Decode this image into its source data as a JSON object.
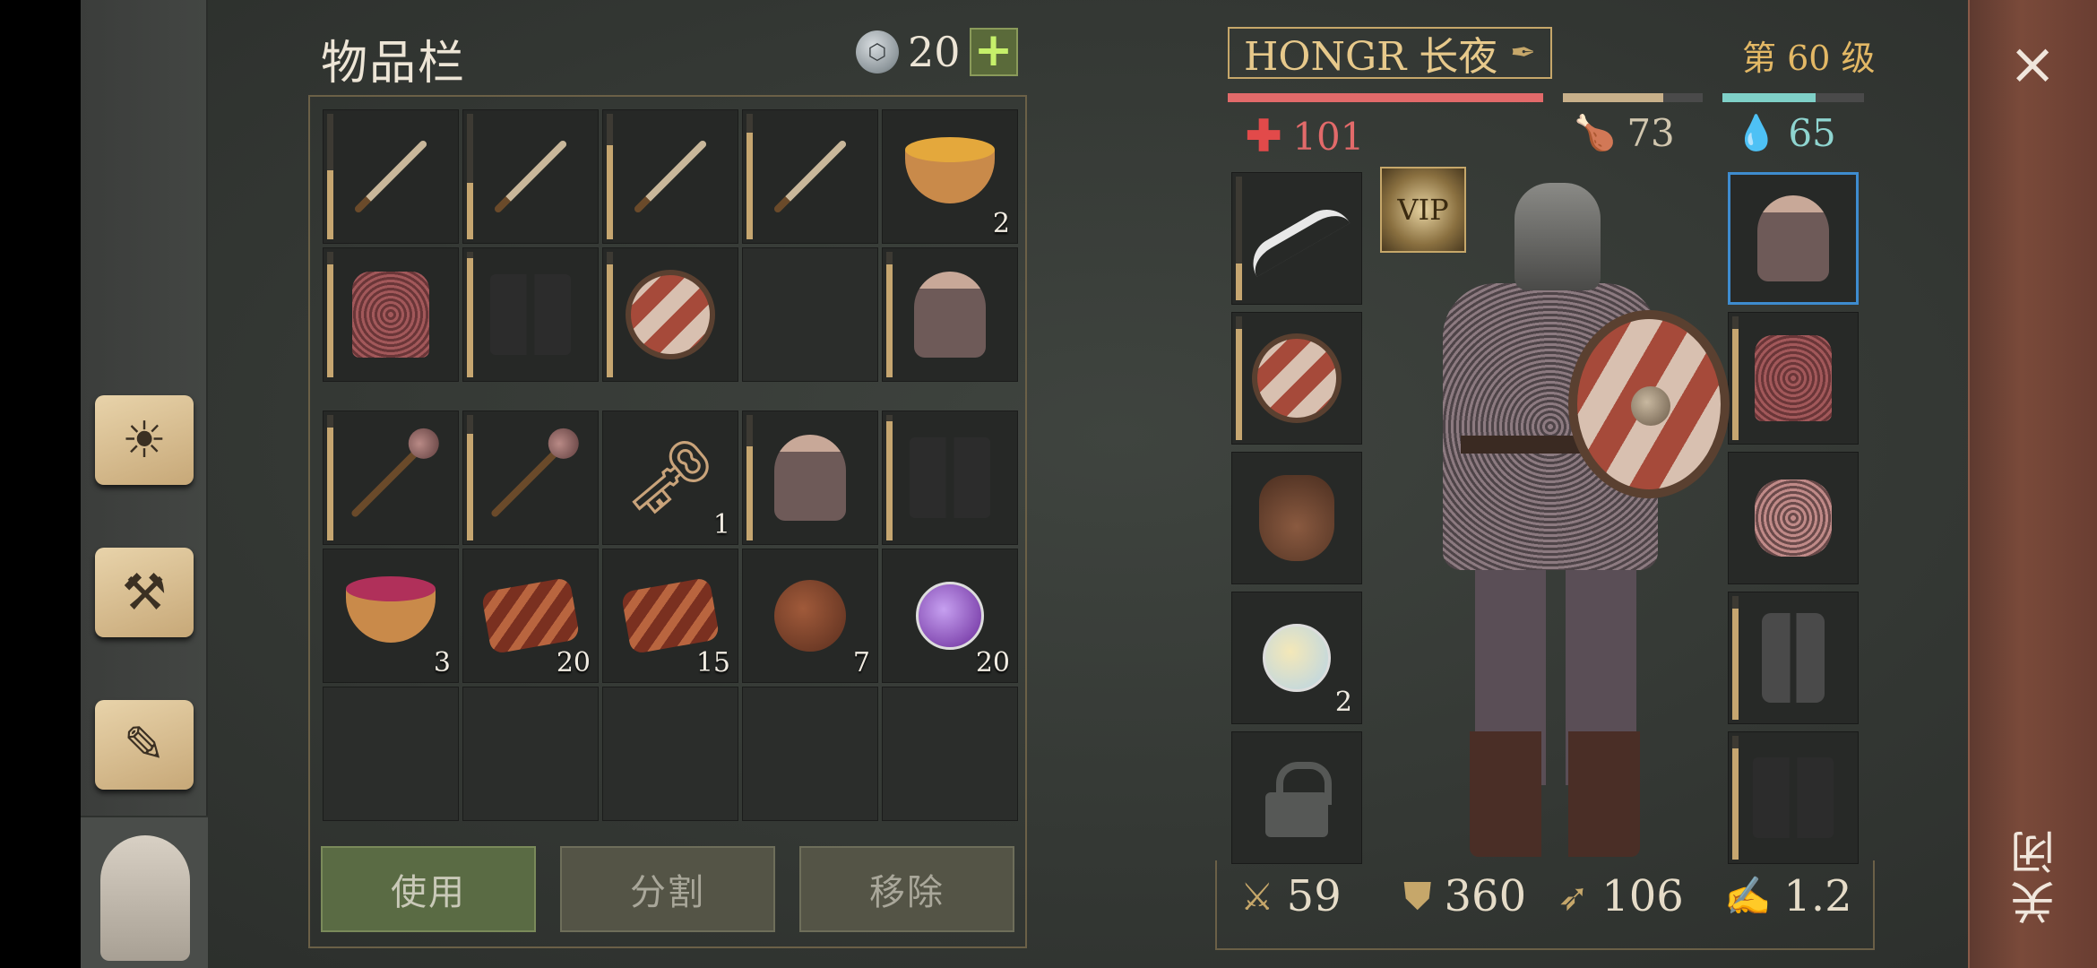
{
  "inventory": {
    "title": "物品栏",
    "currency_value": "20",
    "add_label": "+",
    "items_top": [
      {
        "name": "sword",
        "durability": 0.55,
        "count": ""
      },
      {
        "name": "sword",
        "durability": 0.45,
        "count": ""
      },
      {
        "name": "sword",
        "durability": 0.75,
        "count": ""
      },
      {
        "name": "sword",
        "durability": 0.85,
        "count": ""
      },
      {
        "name": "soup-bowl",
        "durability": null,
        "count": "2"
      },
      {
        "name": "chainmail",
        "durability": 0.9,
        "count": ""
      },
      {
        "name": "boots",
        "durability": 0.95,
        "count": ""
      },
      {
        "name": "round-shield",
        "durability": 0.9,
        "count": ""
      },
      {
        "name": "empty",
        "durability": null,
        "count": ""
      },
      {
        "name": "great-helm",
        "durability": 0.9,
        "count": ""
      }
    ],
    "items_bottom": [
      {
        "name": "mace",
        "durability": 0.9,
        "count": ""
      },
      {
        "name": "mace",
        "durability": 0.85,
        "count": ""
      },
      {
        "name": "key",
        "durability": null,
        "count": "1"
      },
      {
        "name": "great-helm",
        "durability": 0.75,
        "count": ""
      },
      {
        "name": "boots",
        "durability": 0.95,
        "count": ""
      },
      {
        "name": "berry-bowl",
        "durability": null,
        "count": "3"
      },
      {
        "name": "bacon",
        "durability": null,
        "count": "20"
      },
      {
        "name": "bacon",
        "durability": null,
        "count": "15"
      },
      {
        "name": "water-flask",
        "durability": null,
        "count": "7"
      },
      {
        "name": "purple-potion",
        "durability": null,
        "count": "20"
      },
      {
        "name": "empty",
        "durability": null,
        "count": ""
      },
      {
        "name": "empty",
        "durability": null,
        "count": ""
      },
      {
        "name": "empty",
        "durability": null,
        "count": ""
      },
      {
        "name": "empty",
        "durability": null,
        "count": ""
      },
      {
        "name": "empty",
        "durability": null,
        "count": ""
      }
    ],
    "buttons": {
      "use": "使用",
      "split": "分割",
      "remove": "移除"
    }
  },
  "character": {
    "name": "HONGR 长夜",
    "level": "第 60 级",
    "health": "101",
    "food": "73",
    "water": "65",
    "health_fill": 1.0,
    "food_fill": 0.72,
    "water_fill": 0.66,
    "vip_label": "VIP",
    "equip_left": [
      {
        "name": "scimitar",
        "durability": 0.3,
        "count": ""
      },
      {
        "name": "round-shield",
        "durability": 0.9,
        "count": ""
      },
      {
        "name": "pouch",
        "durability": null,
        "count": ""
      },
      {
        "name": "clear-potion",
        "durability": null,
        "count": "2"
      },
      {
        "name": "locked",
        "durability": null,
        "count": ""
      }
    ],
    "equip_right": [
      {
        "name": "great-helm",
        "durability": null,
        "count": "",
        "selected": true
      },
      {
        "name": "chainmail",
        "durability": 0.9,
        "count": ""
      },
      {
        "name": "mail-gloves",
        "durability": null,
        "count": ""
      },
      {
        "name": "greaves",
        "durability": 0.9,
        "count": ""
      },
      {
        "name": "boots",
        "durability": 0.9,
        "count": ""
      }
    ],
    "combat": {
      "attack": "59",
      "armor": "360",
      "speed": "106",
      "weight": "1.2"
    }
  },
  "close": {
    "icon": "×",
    "label": "关闭"
  },
  "colors": {
    "health": "#e26a6a",
    "food": "#c8b08a",
    "water": "#7fd0c8",
    "accent": "#c6a76a"
  }
}
